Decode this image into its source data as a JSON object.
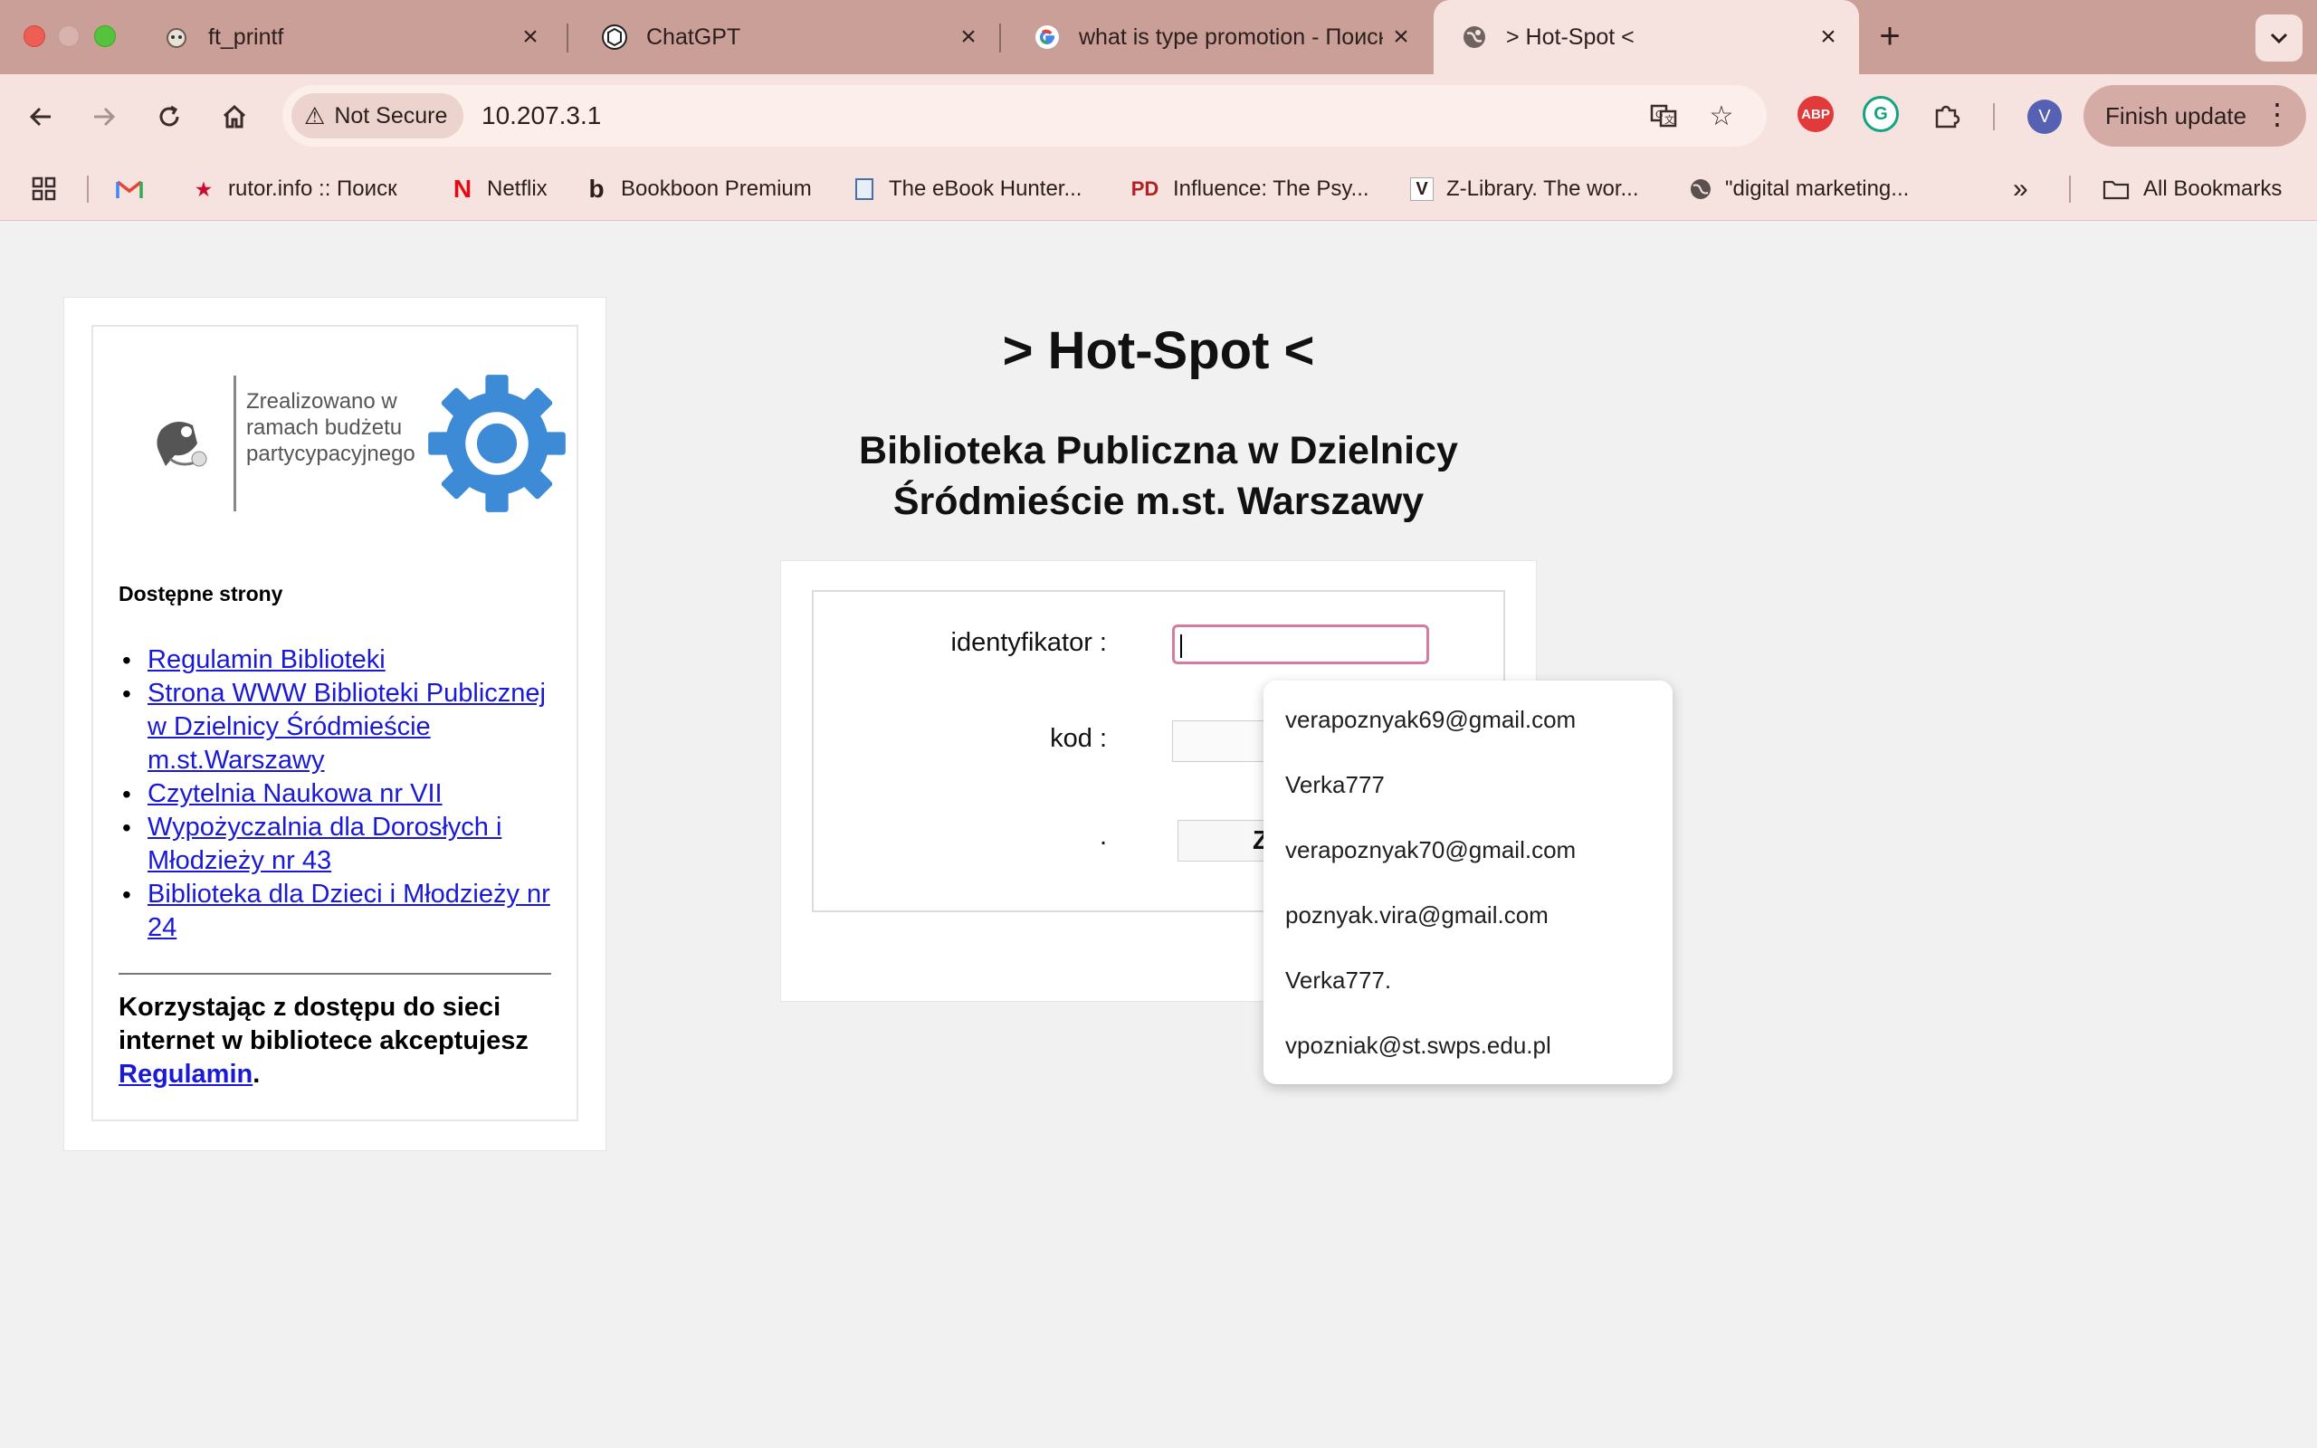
{
  "browser": {
    "tabs": [
      {
        "title": "ft_printf",
        "icon": "cat-icon"
      },
      {
        "title": "ChatGPT",
        "icon": "openai-icon"
      },
      {
        "title": "what is type promotion - Поиск",
        "icon": "google-icon"
      },
      {
        "title": "> Hot-Spot <",
        "icon": "globe-icon",
        "active": true
      }
    ],
    "security_label": "Not Secure",
    "url": "10.207.3.1",
    "profile_initial": "V",
    "finish_update_label": "Finish update",
    "bookmarks": [
      {
        "label": "rutor.info :: Поиск"
      },
      {
        "label": "Netflix"
      },
      {
        "label": "Bookboon Premium"
      },
      {
        "label": "The eBook Hunter..."
      },
      {
        "label": "Influence: The Psy..."
      },
      {
        "label": "Z-Library. The wor..."
      },
      {
        "label": "\"digital marketing..."
      }
    ],
    "all_bookmarks_label": "All Bookmarks",
    "extensions": {
      "abp": "ABP"
    }
  },
  "sidebar": {
    "logo_text": "Zrealizowano w ramach budżetu partycypacyjnego",
    "available_pages_title": "Dostępne strony",
    "links": [
      "Regulamin Biblioteki",
      "Strona WWW Biblioteki Publicznej w Dzielnicy Śródmieście m.st.Warszawy",
      "Czytelnia Naukowa nr VII",
      "Wypożyczalnia dla Dorosłych i Młodzieży nr 43",
      "Biblioteka dla Dzieci i Młodzieży nr 24"
    ],
    "accept_text": "Korzystając z dostępu do sieci internet w bibliotece akceptujesz",
    "accept_link": "Regulamin",
    "accept_end": "."
  },
  "main": {
    "title": "> Hot-Spot <",
    "subtitle_line1": "Biblioteka Publiczna w Dzielnicy",
    "subtitle_line2": "Śródmieście m.st. Warszawy",
    "form": {
      "id_label": "identyfikator :",
      "id_value": "",
      "code_label": "kod :",
      "submit_label_row": ".",
      "submit_button_visible_text": "Z"
    }
  },
  "autofill": {
    "suggestions": [
      "verapoznyak69@gmail.com",
      "Verka777",
      "verapoznyak70@gmail.com",
      "poznyak.vira@gmail.com",
      "Verka777.",
      "vpozniak@st.swps.edu.pl"
    ]
  },
  "colors": {
    "tabstrip": "#c99f98",
    "toolbar": "#f6e3df",
    "link": "#1919d6",
    "focus_border": "#d77aa0",
    "gear": "#3d8bd6"
  }
}
